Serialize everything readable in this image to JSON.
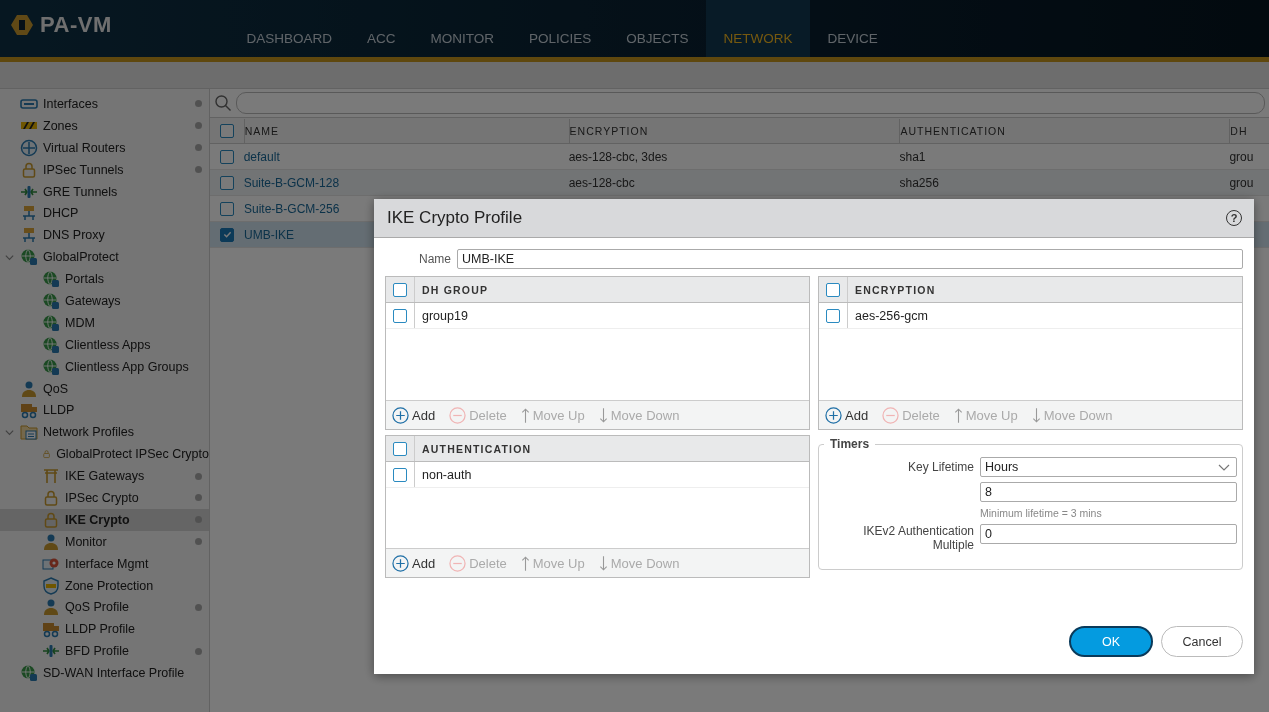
{
  "app": {
    "logo": "PA-VM"
  },
  "nav_tabs": [
    {
      "label": "DASHBOARD",
      "selected": false
    },
    {
      "label": "ACC",
      "selected": false
    },
    {
      "label": "MONITOR",
      "selected": false
    },
    {
      "label": "POLICIES",
      "selected": false
    },
    {
      "label": "OBJECTS",
      "selected": false
    },
    {
      "label": "NETWORK",
      "selected": true
    },
    {
      "label": "DEVICE",
      "selected": false
    }
  ],
  "sidebar": {
    "items": [
      {
        "label": "Interfaces",
        "dot": true,
        "selected": false
      },
      {
        "label": "Zones",
        "dot": true,
        "selected": false
      },
      {
        "label": "Virtual Routers",
        "dot": true,
        "selected": false
      },
      {
        "label": "IPSec Tunnels",
        "dot": true,
        "selected": false
      },
      {
        "label": "GRE Tunnels",
        "dot": false,
        "selected": false
      },
      {
        "label": "DHCP",
        "dot": false,
        "selected": false
      },
      {
        "label": "DNS Proxy",
        "dot": false,
        "selected": false
      },
      {
        "label": "GlobalProtect",
        "dot": false,
        "selected": false,
        "expanded": true,
        "children": [
          {
            "label": "Portals",
            "dot": false,
            "selected": false
          },
          {
            "label": "Gateways",
            "dot": false,
            "selected": false
          },
          {
            "label": "MDM",
            "dot": false,
            "selected": false
          },
          {
            "label": "Clientless Apps",
            "dot": false,
            "selected": false
          },
          {
            "label": "Clientless App Groups",
            "dot": false,
            "selected": false
          }
        ]
      },
      {
        "label": "QoS",
        "dot": false,
        "selected": false
      },
      {
        "label": "LLDP",
        "dot": false,
        "selected": false
      },
      {
        "label": "Network Profiles",
        "dot": false,
        "selected": false,
        "expanded": true,
        "children": [
          {
            "label": "GlobalProtect IPSec Crypto",
            "dot": false,
            "selected": false
          },
          {
            "label": "IKE Gateways",
            "dot": true,
            "selected": false
          },
          {
            "label": "IPSec Crypto",
            "dot": true,
            "selected": false
          },
          {
            "label": "IKE Crypto",
            "dot": true,
            "selected": true
          },
          {
            "label": "Monitor",
            "dot": true,
            "selected": false
          },
          {
            "label": "Interface Mgmt",
            "dot": false,
            "selected": false
          },
          {
            "label": "Zone Protection",
            "dot": false,
            "selected": false
          },
          {
            "label": "QoS Profile",
            "dot": true,
            "selected": false
          },
          {
            "label": "LLDP Profile",
            "dot": false,
            "selected": false
          },
          {
            "label": "BFD Profile",
            "dot": true,
            "selected": false
          }
        ]
      },
      {
        "label": "SD-WAN Interface Profile",
        "dot": false,
        "selected": false
      }
    ]
  },
  "table": {
    "all_checked": false,
    "columns": [
      "NAME",
      "ENCRYPTION",
      "AUTHENTICATION",
      "DH"
    ],
    "rows": [
      {
        "checked": false,
        "selected": false,
        "cells": [
          "default",
          "aes-128-cbc, 3des",
          "sha1",
          "grou"
        ]
      },
      {
        "checked": false,
        "selected": false,
        "cells": [
          "Suite-B-GCM-128",
          "aes-128-cbc",
          "sha256",
          "grou"
        ]
      },
      {
        "checked": false,
        "selected": false,
        "cells": [
          "Suite-B-GCM-256"
        ]
      },
      {
        "checked": true,
        "selected": true,
        "cells": [
          "UMB-IKE"
        ]
      }
    ]
  },
  "dialog": {
    "title": "IKE Crypto Profile",
    "help": "?",
    "name_label": "Name",
    "name_value": "UMB-IKE",
    "grids": [
      {
        "header": "DH GROUP",
        "all_checked": false,
        "rows": [
          {
            "label": "group19",
            "checked": false
          }
        ],
        "actions": [
          {
            "kind": "add",
            "label": "Add",
            "disabled": false
          },
          {
            "kind": "delete",
            "label": "Delete",
            "disabled": true
          },
          {
            "kind": "up",
            "label": "Move Up",
            "disabled": true
          },
          {
            "kind": "down",
            "label": "Move Down",
            "disabled": true
          }
        ]
      },
      {
        "header": "AUTHENTICATION",
        "all_checked": false,
        "rows": [
          {
            "label": "non-auth",
            "checked": false
          }
        ],
        "actions": [
          {
            "kind": "add",
            "label": "Add",
            "disabled": false
          },
          {
            "kind": "delete",
            "label": "Delete",
            "disabled": true
          },
          {
            "kind": "up",
            "label": "Move Up",
            "disabled": true
          },
          {
            "kind": "down",
            "label": "Move Down",
            "disabled": true
          }
        ]
      },
      {
        "header": "ENCRYPTION",
        "all_checked": false,
        "rows": [
          {
            "label": "aes-256-gcm",
            "checked": false
          }
        ],
        "actions": [
          {
            "kind": "add",
            "label": "Add",
            "disabled": false
          },
          {
            "kind": "delete",
            "label": "Delete",
            "disabled": true
          },
          {
            "kind": "up",
            "label": "Move Up",
            "disabled": true
          },
          {
            "kind": "down",
            "label": "Move Down",
            "disabled": true
          }
        ]
      }
    ],
    "timers": {
      "legend": "Timers",
      "key_lifetime_label": "Key Lifetime",
      "key_lifetime_unit": "Hours",
      "key_lifetime_value": "8",
      "hint": "Minimum lifetime = 3 mins",
      "ikev2_label": "IKEv2 Authentication Multiple",
      "ikev2_value": "0"
    },
    "buttons": [
      {
        "label": "OK",
        "kind": "primary"
      },
      {
        "label": "Cancel",
        "kind": "secondary"
      }
    ]
  }
}
